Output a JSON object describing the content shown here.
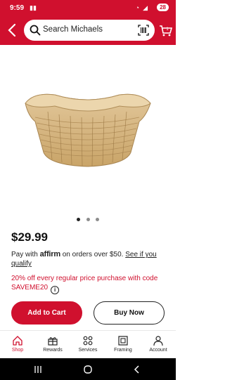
{
  "status": {
    "time": "9:59",
    "battery": "28"
  },
  "search": {
    "placeholder": "Search Michaels"
  },
  "product": {
    "price": "$29.99",
    "affirm": {
      "prefix": "Pay with",
      "brand": "affirm",
      "suffix": "on orders over $50.",
      "link": "See if you qualify"
    },
    "promo": {
      "text": "20% off every regular price purchase with code SAVEME20"
    }
  },
  "actions": {
    "add_to_cart": "Add to Cart",
    "buy_now": "Buy Now"
  },
  "nav": [
    {
      "label": "Shop",
      "icon": "home-icon"
    },
    {
      "label": "Rewards",
      "icon": "gift-icon"
    },
    {
      "label": "Services",
      "icon": "grid-icon"
    },
    {
      "label": "Framing",
      "icon": "frame-icon"
    },
    {
      "label": "Account",
      "icon": "person-icon"
    }
  ],
  "colors": {
    "brand": "#d0102e"
  }
}
